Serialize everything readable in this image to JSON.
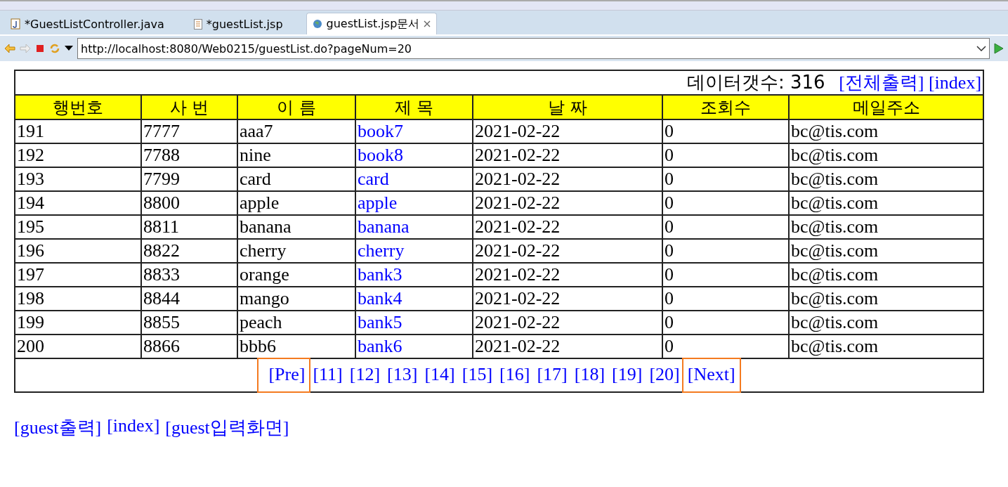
{
  "tabs": [
    {
      "label": "*GuestListController.java",
      "kind": "java",
      "selected": false
    },
    {
      "label": "*guestList.jsp",
      "kind": "jsp",
      "selected": false
    },
    {
      "label": "guestList.jsp문서",
      "kind": "browser",
      "selected": true
    }
  ],
  "address_bar": {
    "value": "http://localhost:8080/Web0215/guestList.do?pageNum=20"
  },
  "summary": {
    "label": "데이터갯수: 316",
    "links": [
      "[전체출력]",
      "[index]"
    ]
  },
  "table": {
    "columns": [
      "행번호",
      "사 번",
      "이 름",
      "제 목",
      "날 짜",
      "조회수",
      "메일주소"
    ],
    "rows": [
      [
        "191",
        "7777",
        "aaa7",
        "book7",
        "2021-02-22",
        "0",
        "bc@tis.com"
      ],
      [
        "192",
        "7788",
        "nine",
        "book8",
        "2021-02-22",
        "0",
        "bc@tis.com"
      ],
      [
        "193",
        "7799",
        "card",
        "card",
        "2021-02-22",
        "0",
        "bc@tis.com"
      ],
      [
        "194",
        "8800",
        "apple",
        "apple",
        "2021-02-22",
        "0",
        "bc@tis.com"
      ],
      [
        "195",
        "8811",
        "banana",
        "banana",
        "2021-02-22",
        "0",
        "bc@tis.com"
      ],
      [
        "196",
        "8822",
        "cherry",
        "cherry",
        "2021-02-22",
        "0",
        "bc@tis.com"
      ],
      [
        "197",
        "8833",
        "orange",
        "bank3",
        "2021-02-22",
        "0",
        "bc@tis.com"
      ],
      [
        "198",
        "8844",
        "mango",
        "bank4",
        "2021-02-22",
        "0",
        "bc@tis.com"
      ],
      [
        "199",
        "8855",
        "peach",
        "bank5",
        "2021-02-22",
        "0",
        "bc@tis.com"
      ],
      [
        "200",
        "8866",
        "bbb6",
        "bank6",
        "2021-02-22",
        "0",
        "bc@tis.com"
      ]
    ]
  },
  "pagination": [
    {
      "label": "[Pre]",
      "highlighted": true
    },
    {
      "label": "[11]",
      "highlighted": false
    },
    {
      "label": "[12]",
      "highlighted": false
    },
    {
      "label": "[13]",
      "highlighted": false
    },
    {
      "label": "[14]",
      "highlighted": false
    },
    {
      "label": "[15]",
      "highlighted": false
    },
    {
      "label": "[16]",
      "highlighted": false
    },
    {
      "label": "[17]",
      "highlighted": false
    },
    {
      "label": "[18]",
      "highlighted": false
    },
    {
      "label": "[19]",
      "highlighted": false
    },
    {
      "label": "[20]",
      "highlighted": false
    },
    {
      "label": "[Next]",
      "highlighted": true
    }
  ],
  "footer_links": [
    "[guest출력]",
    "[index]",
    "[guest입력화면]"
  ]
}
